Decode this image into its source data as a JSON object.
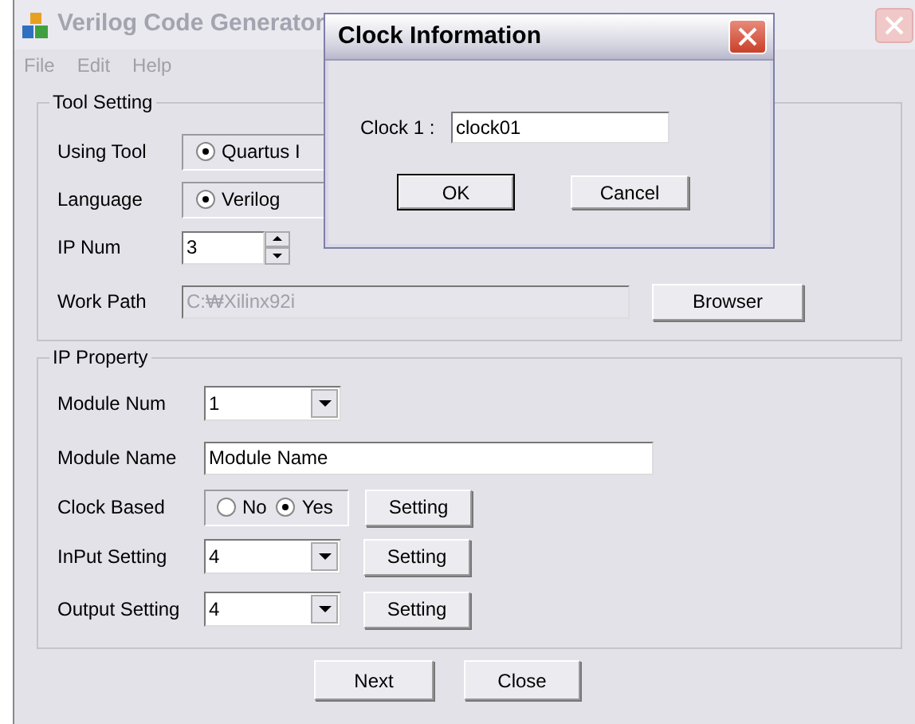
{
  "window": {
    "title": "Verilog Code Generator",
    "menu": [
      "File",
      "Edit",
      "Help"
    ]
  },
  "tool_setting": {
    "title": "Tool Setting",
    "using_tool": {
      "label": "Using Tool",
      "option": {
        "label": "Quartus I",
        "selected": true
      }
    },
    "language": {
      "label": "Language",
      "option": {
        "label": "Verilog",
        "selected": true
      }
    },
    "ip_num": {
      "label": "IP Num",
      "value": "3"
    },
    "work_path": {
      "label": "Work Path",
      "value": "C:₩Xilinx92i",
      "disabled": true
    },
    "browse_button": "Browser"
  },
  "ip_property": {
    "title": "IP Property",
    "module_num": {
      "label": "Module Num",
      "value": "1"
    },
    "module_name": {
      "label": "Module Name",
      "value": "Module Name"
    },
    "clock_based": {
      "label": "Clock Based",
      "options": [
        {
          "label": "No",
          "selected": false
        },
        {
          "label": "Yes",
          "selected": true
        }
      ],
      "button": "Setting"
    },
    "input_setting": {
      "label": "InPut Setting",
      "value": "4",
      "button": "Setting"
    },
    "output_setting": {
      "label": "Output Setting",
      "value": "4",
      "button": "Setting"
    }
  },
  "buttons": [
    "Next",
    "Close"
  ],
  "dialog": {
    "title": "Clock Information",
    "field_label": "Clock 1 :",
    "field_value": "clock01",
    "buttons": [
      {
        "label": "OK",
        "default": true
      },
      {
        "label": "Cancel",
        "default": false
      }
    ]
  }
}
